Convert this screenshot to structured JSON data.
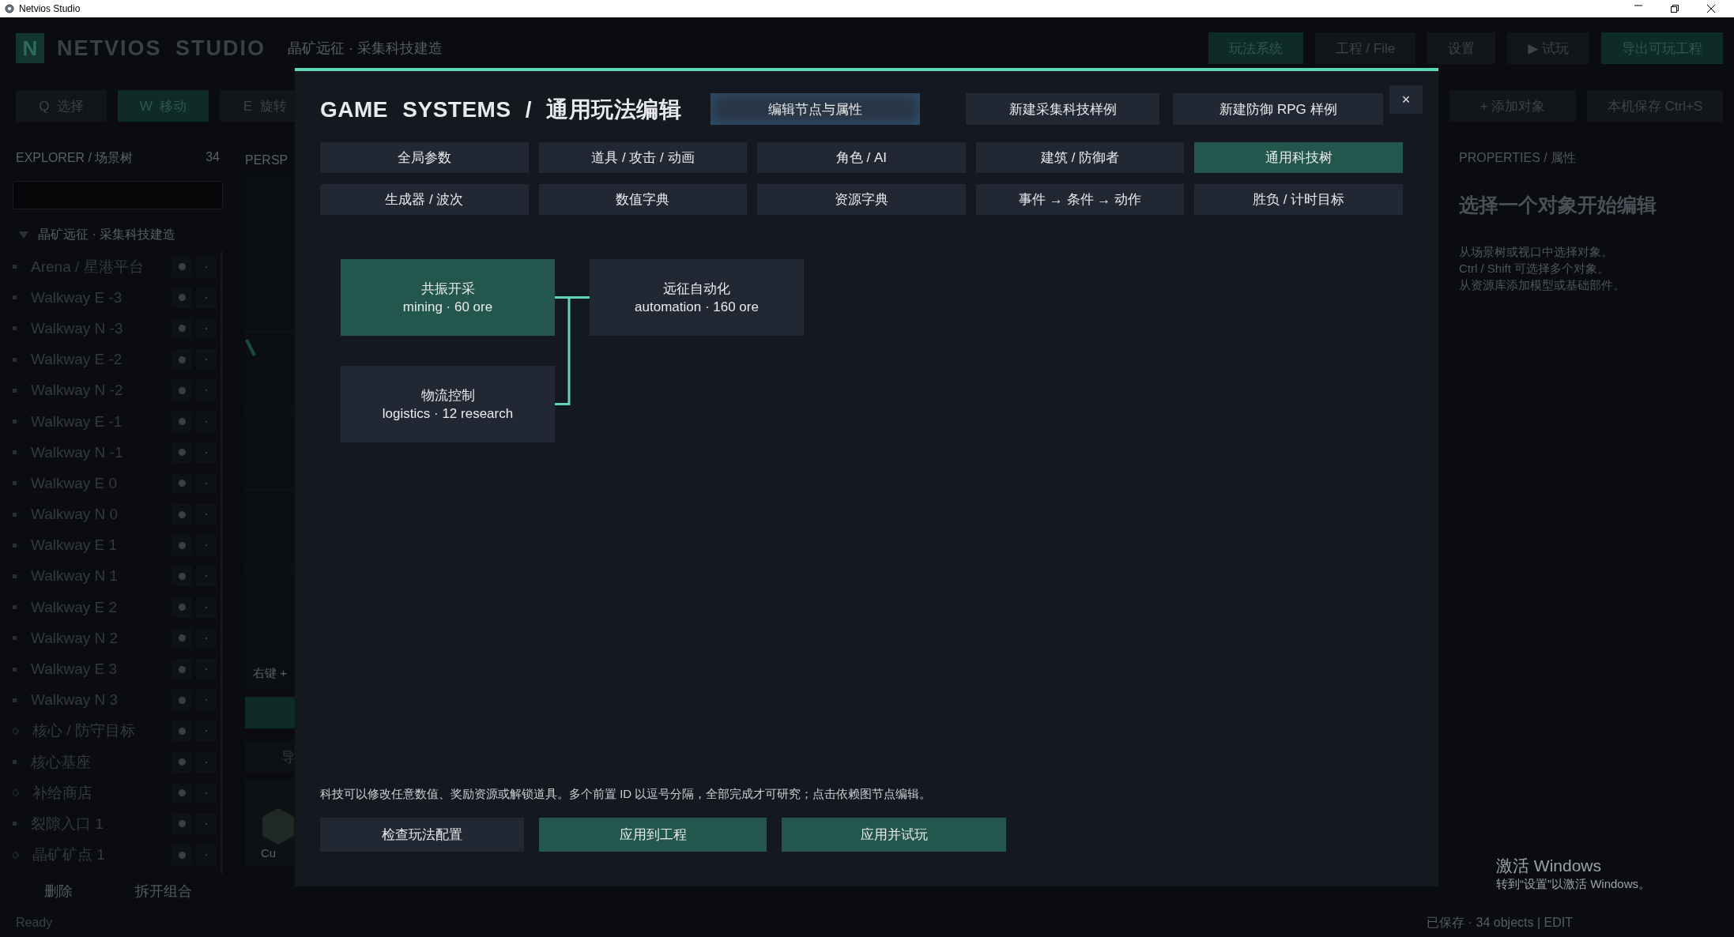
{
  "window": {
    "title": "Netvios Studio"
  },
  "header": {
    "logo": "N",
    "app_name": "NETVIOS STUDIO",
    "project": "晶矿远征 · 采集科技建造",
    "buttons": [
      {
        "label": "玩法系统",
        "kind": "primary"
      },
      {
        "label": "工程 / File",
        "kind": "plain"
      },
      {
        "label": "设置",
        "kind": "plain"
      },
      {
        "label": "▶ 试玩",
        "kind": "plain"
      },
      {
        "label": "导出可玩工程",
        "kind": "primary"
      }
    ]
  },
  "toolbar": {
    "tools": [
      {
        "key": "Q",
        "label": "选择",
        "selected": false
      },
      {
        "key": "W",
        "label": "移动",
        "selected": true
      },
      {
        "key": "E",
        "label": "旋转",
        "selected": false
      }
    ],
    "actions": [
      "+ 添加对象",
      "本机保存 Ctrl+S"
    ]
  },
  "explorer": {
    "title": "EXPLORER / 场景树",
    "count": "34",
    "root": "晶矿远征 · 采集科技建造",
    "expanded": true,
    "items": [
      {
        "label": "Arena / 星港平台",
        "kind": "object"
      },
      {
        "label": "Walkway E -3",
        "kind": "object"
      },
      {
        "label": "Walkway N -3",
        "kind": "object"
      },
      {
        "label": "Walkway E -2",
        "kind": "object"
      },
      {
        "label": "Walkway N -2",
        "kind": "object"
      },
      {
        "label": "Walkway E -1",
        "kind": "object"
      },
      {
        "label": "Walkway N -1",
        "kind": "object"
      },
      {
        "label": "Walkway E 0",
        "kind": "object"
      },
      {
        "label": "Walkway N 0",
        "kind": "object"
      },
      {
        "label": "Walkway E 1",
        "kind": "object"
      },
      {
        "label": "Walkway N 1",
        "kind": "object"
      },
      {
        "label": "Walkway E 2",
        "kind": "object"
      },
      {
        "label": "Walkway N 2",
        "kind": "object"
      },
      {
        "label": "Walkway E 3",
        "kind": "object"
      },
      {
        "label": "Walkway N 3",
        "kind": "object"
      },
      {
        "label": "核心 / 防守目标",
        "kind": "marker"
      },
      {
        "label": "核心基座",
        "kind": "object"
      },
      {
        "label": "补给商店",
        "kind": "marker"
      },
      {
        "label": "裂隙入口 1",
        "kind": "object"
      },
      {
        "label": "晶矿矿点 1",
        "kind": "marker"
      }
    ],
    "buttons": [
      "删除",
      "拆开组合"
    ]
  },
  "viewport": {
    "label": "PERSP",
    "hint": "右键 +",
    "import_button": "导",
    "asset_label": "Cu"
  },
  "properties": {
    "title": "PROPERTIES / 属性",
    "heading": "选择一个对象开始编辑",
    "hint_lines": [
      "从场景树或视口中选择对象。",
      "Ctrl / Shift 可选择多个对象。",
      "从资源库添加模型或基础部件。"
    ]
  },
  "dialog": {
    "title": "GAME SYSTEMS / 通用玩法编辑",
    "close": "×",
    "actions": [
      {
        "label": "编辑节点与属性",
        "highlighted": true
      },
      {
        "label": "新建采集科技样例",
        "highlighted": false
      },
      {
        "label": "新建防御 RPG 样例",
        "highlighted": false
      }
    ],
    "tabs": [
      {
        "label": "全局参数",
        "selected": false
      },
      {
        "label": "道具 / 攻击 / 动画",
        "selected": false
      },
      {
        "label": "角色 / AI",
        "selected": false
      },
      {
        "label": "建筑 / 防御者",
        "selected": false
      },
      {
        "label": "通用科技树",
        "selected": true
      },
      {
        "label": "生成器 / 波次",
        "selected": false
      },
      {
        "label": "数值字典",
        "selected": false
      },
      {
        "label": "资源字典",
        "selected": false
      },
      {
        "label": "事件 → 条件 → 动作",
        "selected": false
      },
      {
        "label": "胜负 / 计时目标",
        "selected": false
      }
    ],
    "tech_nodes": [
      {
        "name": "远征自动化",
        "detail": "automation · 160 ore",
        "selected": false,
        "prerequisites": [
          {
            "name": "共振开采",
            "detail": "mining · 60 ore",
            "selected": true
          },
          {
            "name": "物流控制",
            "detail": "logistics · 12 research",
            "selected": false
          }
        ]
      }
    ],
    "hint": "科技可以修改任意数值、奖励资源或解锁道具。多个前置 ID 以逗号分隔，全部完成才可研究；点击依赖图节点编辑。",
    "buttons": [
      {
        "label": "检查玩法配置",
        "kind": "plain"
      },
      {
        "label": "应用到工程",
        "kind": "primary"
      },
      {
        "label": "应用并试玩",
        "kind": "primary"
      }
    ]
  },
  "status_bar": {
    "left": "Ready",
    "right": "已保存 · 34 objects | EDIT"
  },
  "os_notice": {
    "title": "激活 Windows",
    "text": "转到“设置”以激活 Windows。"
  }
}
